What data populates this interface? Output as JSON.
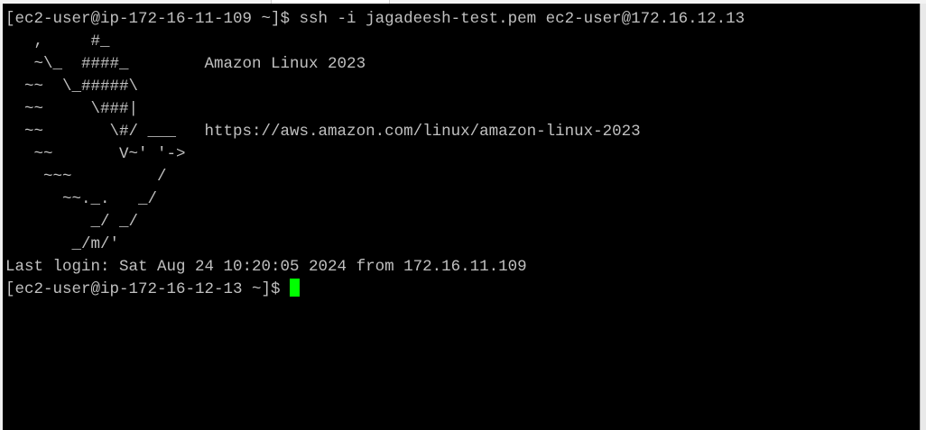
{
  "terminal": {
    "lines": [
      "[ec2-user@ip-172-16-11-109 ~]$ ssh -i jagadeesh-test.pem ec2-user@172.16.12.13",
      "   ,     #_",
      "   ~\\_  ####_        Amazon Linux 2023",
      "  ~~  \\_#####\\",
      "  ~~     \\###|",
      "  ~~       \\#/ ___   https://aws.amazon.com/linux/amazon-linux-2023",
      "   ~~       V~' '->",
      "    ~~~         /",
      "      ~~._.   _/",
      "         _/ _/",
      "       _/m/'",
      "Last login: Sat Aug 24 10:20:05 2024 from 172.16.11.109"
    ],
    "prompt": "[ec2-user@ip-172-16-12-13 ~]$ ",
    "colors": {
      "background": "#000000",
      "text": "#c0c0c0",
      "cursor": "#00ff00"
    }
  }
}
